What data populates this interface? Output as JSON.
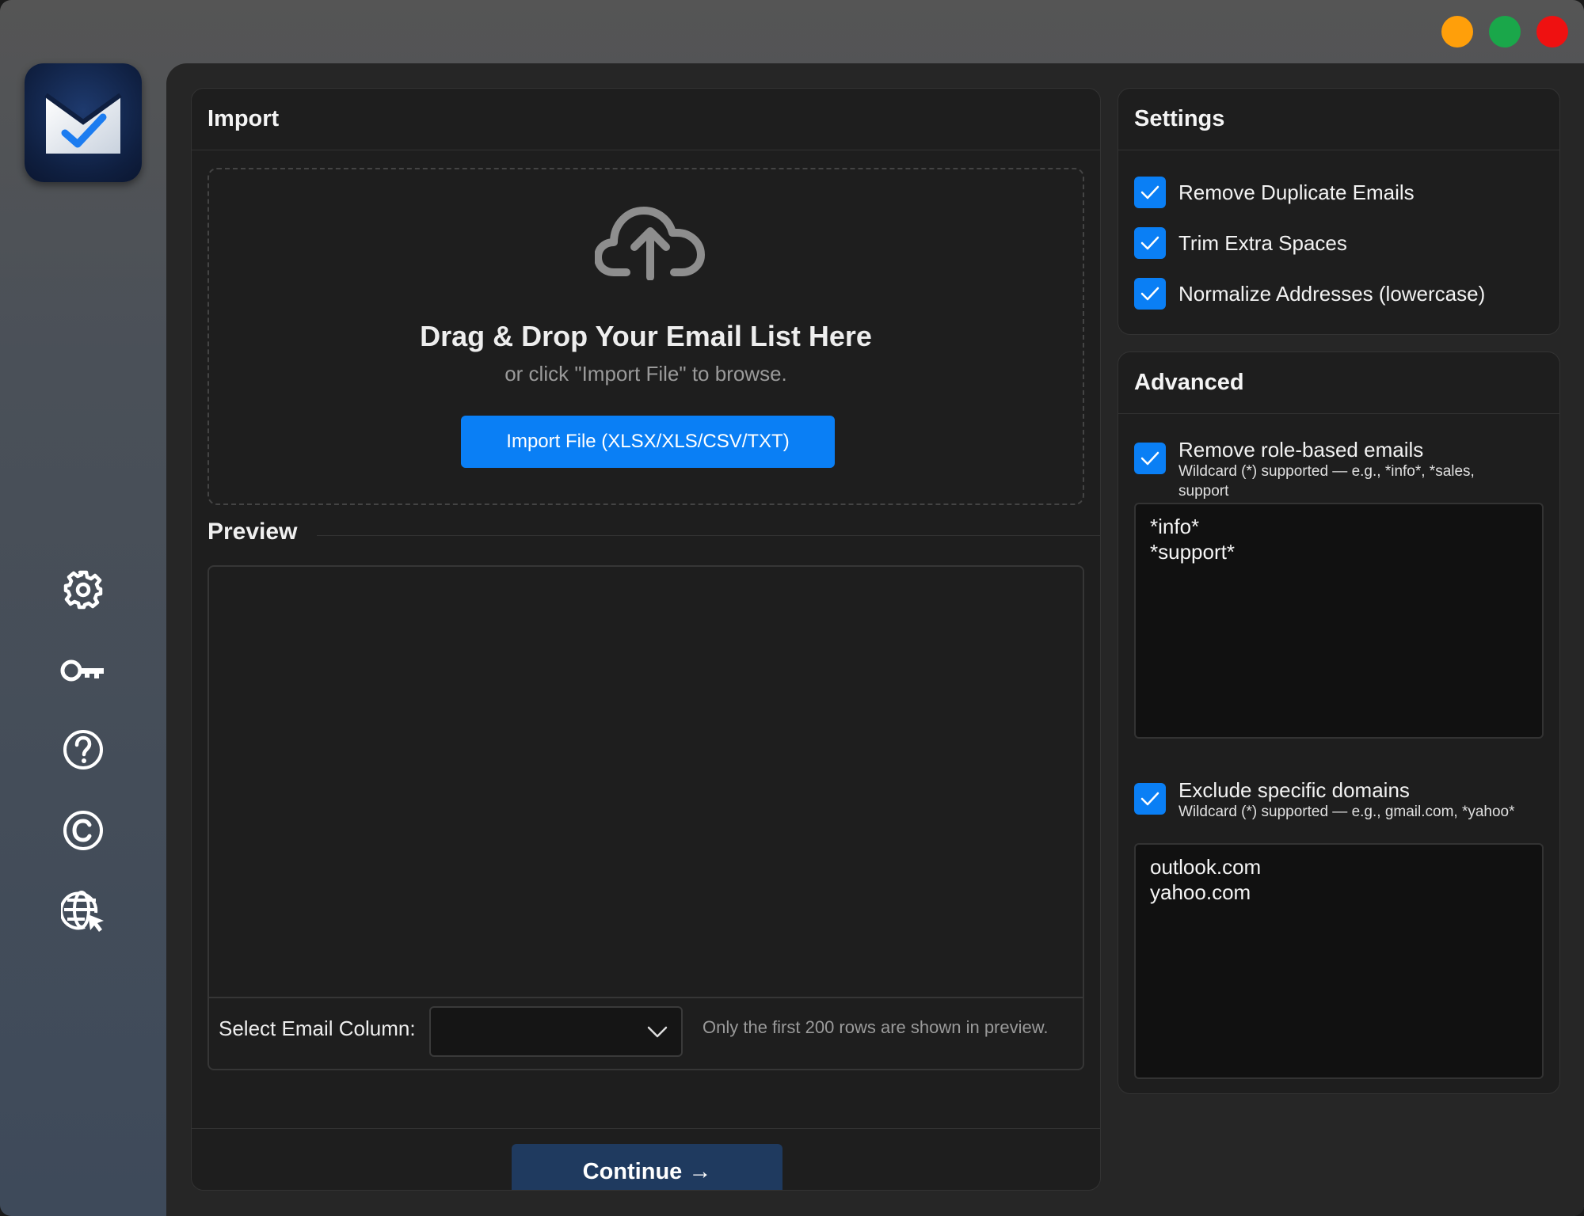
{
  "window": {
    "controls": [
      "minimize",
      "maximize",
      "close"
    ]
  },
  "sidebar": {
    "logo_icon": "mail-check-icon",
    "items": [
      {
        "icon": "gear-icon",
        "name": "settings"
      },
      {
        "icon": "key-icon",
        "name": "license"
      },
      {
        "icon": "help-icon",
        "name": "help"
      },
      {
        "icon": "copyright-icon",
        "name": "about"
      },
      {
        "icon": "globe-cursor-icon",
        "name": "website"
      }
    ]
  },
  "import": {
    "title": "Import",
    "dropzone": {
      "icon": "cloud-upload-icon",
      "title": "Drag & Drop Your Email List Here",
      "subtitle": "or click \"Import File\" to browse.",
      "button_label": "Import File (XLSX/XLS/CSV/TXT)"
    },
    "preview": {
      "label": "Preview",
      "column_label": "Select Email Column:",
      "column_value": "",
      "note": "Only the first 200 rows are shown in preview."
    },
    "continue_label": "Continue →"
  },
  "settings": {
    "title": "Settings",
    "options": [
      {
        "label": "Remove Duplicate Emails",
        "checked": true
      },
      {
        "label": "Trim Extra Spaces",
        "checked": true
      },
      {
        "label": "Normalize Addresses (lowercase)",
        "checked": true
      }
    ]
  },
  "advanced": {
    "title": "Advanced",
    "role_based": {
      "label": "Remove role-based emails",
      "hint": "Wildcard (*) supported — e.g., *info*, *sales, support",
      "checked": true,
      "value": "*info*\n*support*"
    },
    "domains": {
      "label": "Exclude specific domains",
      "hint": "Wildcard (*) supported — e.g., gmail.com, *yahoo*",
      "checked": true,
      "value": "outlook.com\nyahoo.com"
    }
  },
  "colors": {
    "accent": "#0a7ff5",
    "continue_button": "#1f3a5f",
    "traffic_min": "#ff9f0a",
    "traffic_max": "#1aa74a",
    "traffic_close": "#ef1111"
  }
}
